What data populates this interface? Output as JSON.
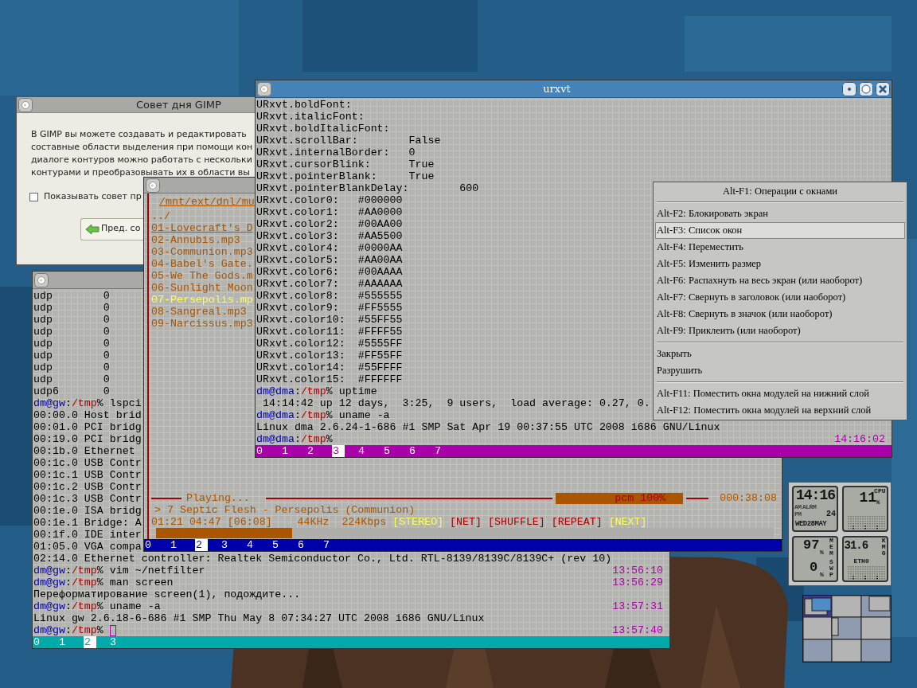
{
  "gimp_tip": {
    "title": "Совет дня GIMP",
    "text_lines": [
      "В GIMP вы можете создавать и редактировать",
      "составные области выделения при помощи кон",
      "диалоге контуров можно работать с нескольки",
      "контурами и преобразовывать их в области вы"
    ],
    "checkbox": {
      "label": "Показывать совет пр",
      "checked": false
    },
    "prev_button": "Пред. со"
  },
  "shell_terminal": {
    "lines": [
      {
        "kind": "output",
        "text": "udp        0"
      },
      {
        "kind": "output",
        "text": "udp        0"
      },
      {
        "kind": "output",
        "text": "udp        0"
      },
      {
        "kind": "output",
        "text": "udp        0"
      },
      {
        "kind": "output",
        "text": "udp        0"
      },
      {
        "kind": "output",
        "text": "udp        0"
      },
      {
        "kind": "output",
        "text": "udp        0"
      },
      {
        "kind": "output",
        "text": "udp        0"
      },
      {
        "kind": "output",
        "text": "udp6       0"
      },
      {
        "kind": "prompt",
        "user_host": "dm@gw",
        "colon": ":",
        "path": "/tmp",
        "sign": "%",
        "command": "lspci"
      },
      {
        "kind": "output",
        "text": "00:00.0 Host brid"
      },
      {
        "kind": "output",
        "text": "00:01.0 PCI bridg"
      },
      {
        "kind": "output",
        "text": "00:19.0 PCI bridg"
      },
      {
        "kind": "output",
        "text": "00:1b.0 Ethernet"
      },
      {
        "kind": "output",
        "text": "00:1c.0 USB Contr"
      },
      {
        "kind": "output",
        "text": "00:1c.1 USB Contr"
      },
      {
        "kind": "output",
        "text": "00:1c.2 USB Contr"
      },
      {
        "kind": "output",
        "text": "00:1c.3 USB Contr"
      },
      {
        "kind": "output",
        "text": "00:1e.0 ISA bridg"
      },
      {
        "kind": "output",
        "text": "00:1e.1 Bridge: A"
      },
      {
        "kind": "output",
        "text": "00:1f.0 IDE inter"
      },
      {
        "kind": "output",
        "text": "01:05.0 VGA compa"
      },
      {
        "kind": "output",
        "text": "02:14.0 Ethernet controller: Realtek Semiconductor Co., Ltd. RTL-8139/8139C/8139C+ (rev 10)"
      },
      {
        "kind": "prompt",
        "user_host": "dm@gw",
        "colon": ":",
        "path": "/tmp",
        "sign": "%",
        "command": "vim ~/netfilter",
        "time": "13:56:10"
      },
      {
        "kind": "prompt",
        "user_host": "dm@gw",
        "colon": ":",
        "path": "/tmp",
        "sign": "%",
        "command": "man screen",
        "time": "13:56:29"
      },
      {
        "kind": "output",
        "text": "Переформатирование screen(1), подождите..."
      },
      {
        "kind": "prompt",
        "user_host": "dm@gw",
        "colon": ":",
        "path": "/tmp",
        "sign": "%",
        "command": "uname -a",
        "time": "13:57:31"
      },
      {
        "kind": "output",
        "text": "Linux gw 2.6.18-6-686 #1 SMP Thu May 8 07:34:27 UTC 2008 i686 GNU/Linux"
      },
      {
        "kind": "prompt",
        "user_host": "dm@gw",
        "colon": ":",
        "path": "/tmp",
        "sign": "%",
        "cursor": true,
        "time": "13:57:40"
      }
    ],
    "window_tabs": [
      {
        "label": "0",
        "selected": false
      },
      {
        "label": "1",
        "selected": false
      },
      {
        "label": "2",
        "selected": true
      },
      {
        "label": "3",
        "selected": false
      }
    ]
  },
  "player": {
    "path": "/mnt/ext/dnl/mu",
    "files": [
      {
        "name": "../",
        "selected": false,
        "playing": false
      },
      {
        "name": "01-Lovecraft's D",
        "selected": true,
        "playing": false
      },
      {
        "name": "02-Annubis.mp3",
        "selected": false,
        "playing": false
      },
      {
        "name": "03-Communion.mp3",
        "selected": false,
        "playing": false
      },
      {
        "name": "04-Babel's Gate.",
        "selected": false,
        "playing": false
      },
      {
        "name": "05-We The Gods.m",
        "selected": false,
        "playing": false
      },
      {
        "name": "06-Sunlight Moon",
        "selected": false,
        "playing": false
      },
      {
        "name": "07-Persepolis.mp",
        "selected": false,
        "playing": true
      },
      {
        "name": "08-Sangreal.mp3",
        "selected": false,
        "playing": false
      },
      {
        "name": "09-Narcissus.mp3",
        "selected": false,
        "playing": false
      }
    ],
    "status": "Playing...",
    "volume": {
      "label": "pcm 100%"
    },
    "elapsed": "000:38:08",
    "now_playing": "> 7 Septic Flesh - Persepolis (Communion)",
    "info": "01:21 04:47 [06:08]    44KHz  224Kbps",
    "flags": [
      {
        "label": "[STEREO]",
        "on": true
      },
      {
        "label": "[NET]",
        "on": false
      },
      {
        "label": "[SHUFFLE]",
        "on": false
      },
      {
        "label": "[REPEAT]",
        "on": false
      },
      {
        "label": "[NEXT]",
        "on": true
      }
    ],
    "progress": {
      "level": 0.22
    },
    "window_tabs": [
      {
        "label": "0",
        "selected": false
      },
      {
        "label": "1",
        "selected": false
      },
      {
        "label": "2",
        "selected": true
      },
      {
        "label": "3",
        "selected": false
      },
      {
        "label": "4",
        "selected": false
      },
      {
        "label": "5",
        "selected": false
      },
      {
        "label": "6",
        "selected": false
      },
      {
        "label": "7",
        "selected": false
      }
    ]
  },
  "urxvt": {
    "title": "urxvt",
    "lines": [
      {
        "kind": "output",
        "text": "URxvt.boldFont:"
      },
      {
        "kind": "output",
        "text": "URxvt.italicFont:"
      },
      {
        "kind": "output",
        "text": "URxvt.boldItalicFont:"
      },
      {
        "kind": "output",
        "text": "URxvt.scrollBar:        False"
      },
      {
        "kind": "output",
        "text": "URxvt.internalBorder:   0"
      },
      {
        "kind": "output",
        "text": "URxvt.cursorBlink:      True"
      },
      {
        "kind": "output",
        "text": "URxvt.pointerBlank:     True"
      },
      {
        "kind": "output",
        "text": "URxvt.pointerBlankDelay:        600"
      },
      {
        "kind": "output",
        "text": "URxvt.color0:   #000000"
      },
      {
        "kind": "output",
        "text": "URxvt.color1:   #AA0000"
      },
      {
        "kind": "output",
        "text": "URxvt.color2:   #00AA00"
      },
      {
        "kind": "output",
        "text": "URxvt.color3:   #AA5500"
      },
      {
        "kind": "output",
        "text": "URxvt.color4:   #0000AA"
      },
      {
        "kind": "output",
        "text": "URxvt.color5:   #AA00AA"
      },
      {
        "kind": "output",
        "text": "URxvt.color6:   #00AAAA"
      },
      {
        "kind": "output",
        "text": "URxvt.color7:   #AAAAAA"
      },
      {
        "kind": "output",
        "text": "URxvt.color8:   #555555"
      },
      {
        "kind": "output",
        "text": "URxvt.color9:   #FF5555"
      },
      {
        "kind": "output",
        "text": "URxvt.color10:  #55FF55"
      },
      {
        "kind": "output",
        "text": "URxvt.color11:  #FFFF55"
      },
      {
        "kind": "output",
        "text": "URxvt.color12:  #5555FF"
      },
      {
        "kind": "output",
        "text": "URxvt.color13:  #FF55FF"
      },
      {
        "kind": "output",
        "text": "URxvt.color14:  #55FFFF"
      },
      {
        "kind": "output",
        "text": "URxvt.color15:  #FFFFFF"
      },
      {
        "kind": "prompt",
        "user_host": "dm@dma",
        "colon": ":",
        "path": "/tmp",
        "sign": "%",
        "command": "uptime"
      },
      {
        "kind": "output",
        "text": " 14:14:42 up 12 days,  3:25,  9 users,  load average: 0.27, 0."
      },
      {
        "kind": "prompt",
        "user_host": "dm@dma",
        "colon": ":",
        "path": "/tmp",
        "sign": "%",
        "command": "uname -a"
      },
      {
        "kind": "output",
        "text": "Linux dma 2.6.24-1-686 #1 SMP Sat Apr 19 00:37:55 UTC 2008 i686 GNU/Linux"
      },
      {
        "kind": "prompt",
        "user_host": "dm@dma",
        "colon": ":",
        "path": "/tmp",
        "sign": "%",
        "time": "14:16:02"
      }
    ],
    "window_tabs": [
      {
        "label": "0",
        "selected": false
      },
      {
        "label": "1",
        "selected": false
      },
      {
        "label": "2",
        "selected": false
      },
      {
        "label": "3",
        "selected": true
      },
      {
        "label": "4",
        "selected": false
      },
      {
        "label": "5",
        "selected": false
      },
      {
        "label": "6",
        "selected": false
      },
      {
        "label": "7",
        "selected": false
      }
    ]
  },
  "window_menu": {
    "items": [
      {
        "kind": "header",
        "label": "Alt-F1: Операции с окнами"
      },
      {
        "kind": "separator"
      },
      {
        "kind": "item",
        "label": "Alt-F2: Блокировать экран",
        "selected": false
      },
      {
        "kind": "item",
        "label": "Alt-F3: Список окон",
        "selected": true
      },
      {
        "kind": "item",
        "label": "Alt-F4: Переместить",
        "selected": false
      },
      {
        "kind": "item",
        "label": "Alt-F5: Изменить размер",
        "selected": false
      },
      {
        "kind": "item",
        "label": "Alt-F6: Распахнуть на весь экран (или наоборот)",
        "selected": false
      },
      {
        "kind": "item",
        "label": "Alt-F7: Свернуть в заголовок (или наоборот)",
        "selected": false
      },
      {
        "kind": "item",
        "label": "Alt-F8: Свернуть в значок (или наоборот)",
        "selected": false
      },
      {
        "kind": "item",
        "label": "Alt-F9: Приклеить (или наоборот)",
        "selected": false
      },
      {
        "kind": "separator"
      },
      {
        "kind": "item",
        "label": "Закрыть",
        "selected": false
      },
      {
        "kind": "item",
        "label": "Разрушить",
        "selected": false
      },
      {
        "kind": "separator"
      },
      {
        "kind": "item",
        "label": "Alt-F11: Поместить окна модулей на нижний слой",
        "selected": false
      },
      {
        "kind": "item",
        "label": "Alt-F12: Поместить окна модулей на верхний слой",
        "selected": false
      }
    ]
  },
  "system_monitor": {
    "clock": {
      "time": "14:16",
      "am": "AM",
      "alarm": "ALRM",
      "pm": "PM",
      "seconds": "24",
      "date": "WED28MAY"
    },
    "cpu": {
      "label": "CPU",
      "value": "11",
      "unit": "%"
    },
    "memory": {
      "mem_label": "MEM",
      "mem_value": "97",
      "mem_unit": "%",
      "swap_label": "SWP",
      "swap_value": "0",
      "swap_unit": "%"
    },
    "network": {
      "value": "31.6",
      "units": [
        "K",
        "M",
        "G"
      ],
      "label": "ETH0"
    }
  }
}
